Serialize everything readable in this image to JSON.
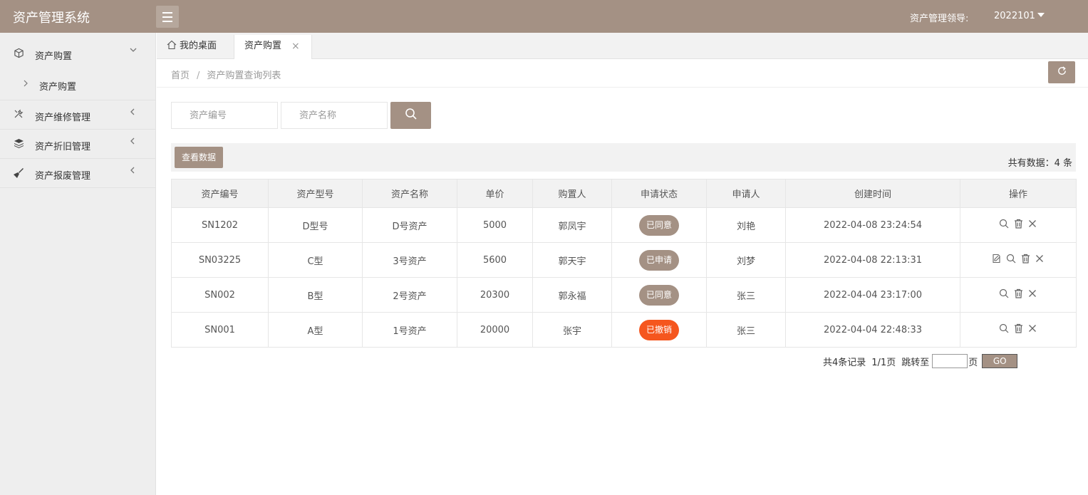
{
  "header": {
    "title": "资产管理系统",
    "user_role": "资产管理领导:",
    "user_name": "2022101"
  },
  "sidebar": {
    "groups": [
      {
        "label": "资产购置",
        "icon": "cube-icon",
        "expanded": true,
        "children": [
          "资产购置"
        ]
      },
      {
        "label": "资产维修管理",
        "icon": "tools-icon",
        "expanded": false
      },
      {
        "label": "资产折旧管理",
        "icon": "layers-icon",
        "expanded": false
      },
      {
        "label": "资产报废管理",
        "icon": "broom-icon",
        "expanded": false
      }
    ]
  },
  "tabs": [
    {
      "label": "我的桌面",
      "icon": "home-icon"
    },
    {
      "label": "资产购置",
      "active": true
    }
  ],
  "breadcrumb": {
    "home": "首页",
    "sep": "/",
    "current": "资产购置查询列表"
  },
  "search": {
    "code_placeholder": "资产编号",
    "name_placeholder": "资产名称"
  },
  "toolbar": {
    "view_label": "查看数据",
    "total_label": "共有数据：4 条"
  },
  "table": {
    "columns": [
      "资产编号",
      "资产型号",
      "资产名称",
      "单价",
      "购置人",
      "申请状态",
      "申请人",
      "创建时间",
      "操作"
    ],
    "rows": [
      {
        "code": "SN1202",
        "model": "D型号",
        "name": "D号资产",
        "price": "5000",
        "buyer": "郭凤宇",
        "status": "已同意",
        "status_color": "#a49184",
        "applicant": "刘艳",
        "created": "2022-04-08 23:24:54",
        "actions": [
          "search-icon",
          "trash-icon",
          "close-icon"
        ]
      },
      {
        "code": "SN03225",
        "model": "C型",
        "name": "3号资产",
        "price": "5600",
        "buyer": "郭天宇",
        "status": "已申请",
        "status_color": "#a49184",
        "applicant": "刘梦",
        "created": "2022-04-08 22:13:31",
        "actions": [
          "edit-icon",
          "search-icon",
          "trash-icon",
          "close-icon"
        ]
      },
      {
        "code": "SN002",
        "model": "B型",
        "name": "2号资产",
        "price": "20300",
        "buyer": "郭永福",
        "status": "已同意",
        "status_color": "#a49184",
        "applicant": "张三",
        "created": "2022-04-04 23:17:00",
        "actions": [
          "search-icon",
          "trash-icon",
          "close-icon"
        ]
      },
      {
        "code": "SN001",
        "model": "A型",
        "name": "1号资产",
        "price": "20000",
        "buyer": "张宇",
        "status": "已撤销",
        "status_color": "#f5561e",
        "applicant": "张三",
        "created": "2022-04-04 22:48:33",
        "actions": [
          "search-icon",
          "trash-icon",
          "close-icon"
        ]
      }
    ]
  },
  "pager": {
    "records": "共4条记录",
    "pages": "1/1页",
    "jump_label": "跳转至",
    "page_suffix": "页",
    "go_label": "GO"
  },
  "colors": {
    "brand": "#a49184",
    "danger": "#f5561e"
  }
}
